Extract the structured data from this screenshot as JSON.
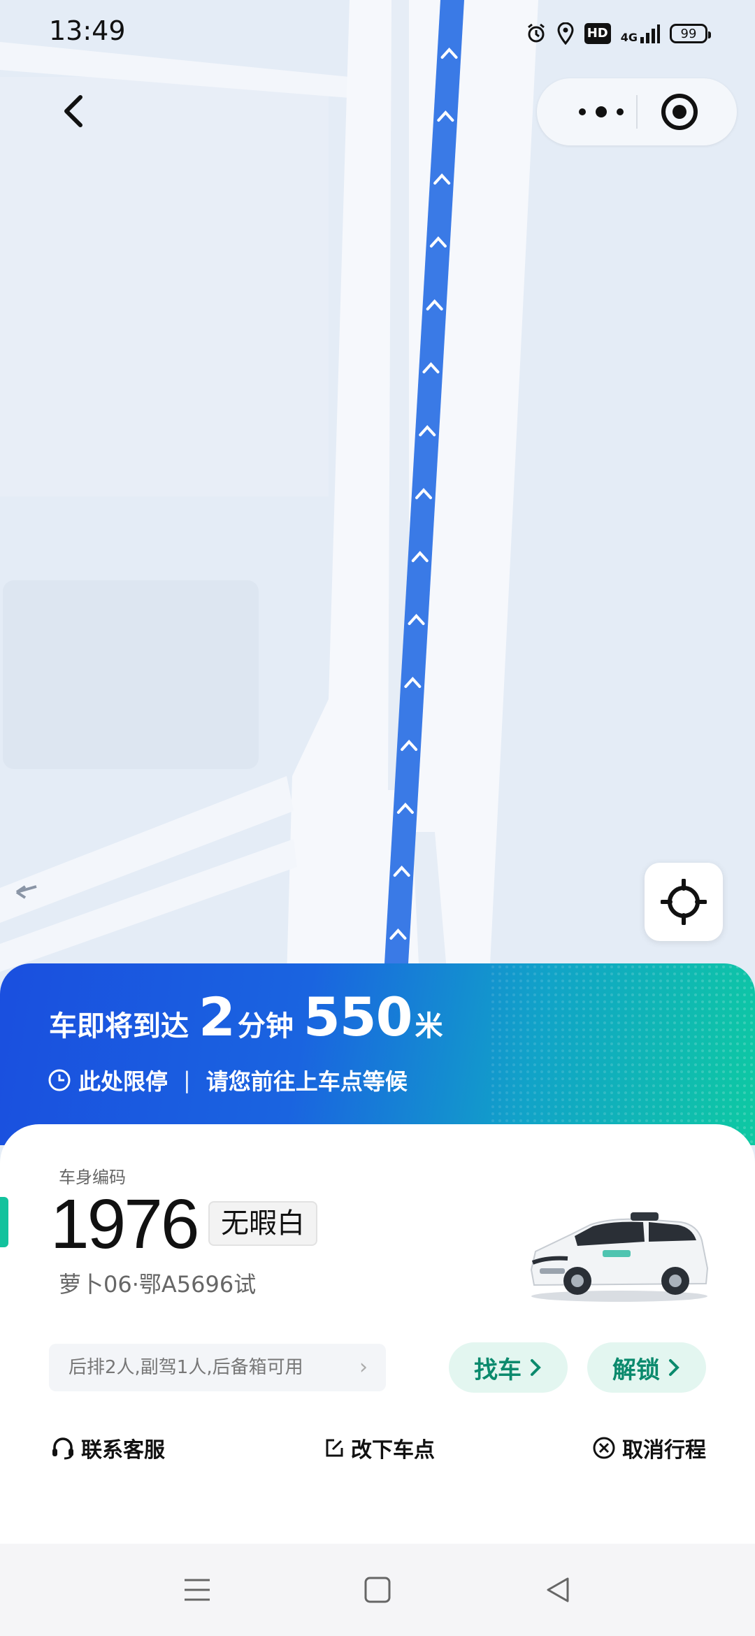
{
  "status_bar": {
    "time": "13:49",
    "icons": [
      "alarm-icon",
      "location-icon",
      "hd-icon",
      "4g-signal-icon",
      "battery-icon"
    ],
    "hd_label": "HD",
    "network_label": "4G",
    "battery_level": "99"
  },
  "map": {
    "route_color": "#3a7ae6",
    "road_color": "#f7f9fc",
    "background_color": "#e4ecf6"
  },
  "top_controls": {
    "back_icon": "chevron-left-icon",
    "more_icon": "more-dots-icon",
    "close_icon": "target-circle-icon"
  },
  "eta": {
    "prefix": "车即将到达",
    "minutes": "2",
    "minutes_unit": "分钟",
    "distance": "550",
    "distance_unit": "米",
    "notice_parking": "此处限停",
    "separator": "|",
    "notice_wait": "请您前往上车点等候",
    "gradient_colors": [
      "#1a4fdf",
      "#0ec9a2"
    ]
  },
  "vehicle": {
    "code_label": "车身编码",
    "number": "1976",
    "name": "无暇白",
    "plate": "萝卜06·鄂A5696试",
    "seat_info": "后排2人,副驾1人,后备箱可用"
  },
  "buttons": {
    "find_car": "找车",
    "unlock": "解锁",
    "accent_color": "#0b8a6d"
  },
  "actions": {
    "contact_service": "联系客服",
    "change_dropoff": "改下车点",
    "cancel_trip": "取消行程"
  },
  "nav_bar": {
    "icons": [
      "menu-icon",
      "home-square-icon",
      "back-triangle-icon"
    ]
  }
}
